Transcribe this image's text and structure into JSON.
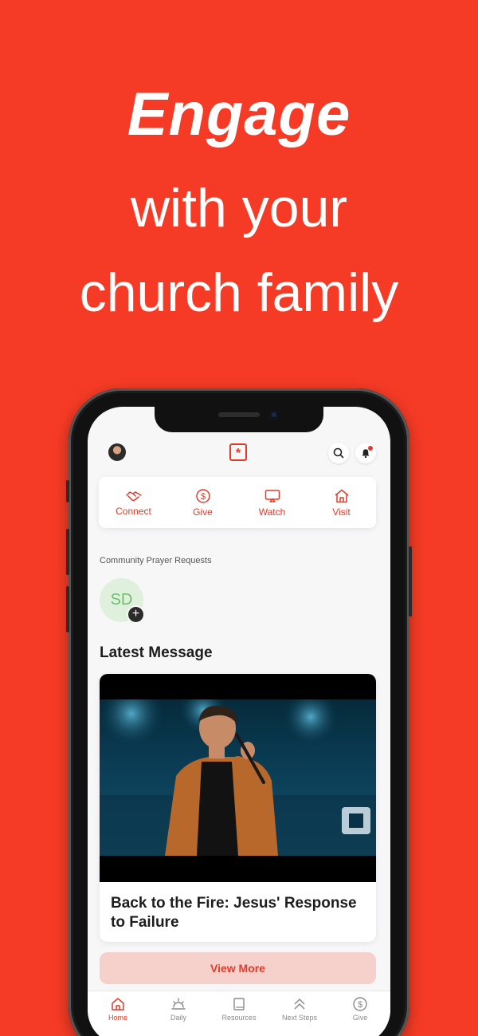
{
  "hero": {
    "line1": "Engage",
    "line2": "with your",
    "line3": "church family"
  },
  "colors": {
    "brand": "#f53b25",
    "accent": "#e23a2a",
    "prayer_bg": "#dff1dc",
    "prayer_text": "#6fbf6a"
  },
  "app": {
    "header": {
      "logo_glyph": "*",
      "icons": [
        "avatar",
        "logo-icon",
        "search-icon",
        "bell-icon"
      ]
    },
    "quick_actions": [
      {
        "label": "Connect",
        "icon": "handshake-icon"
      },
      {
        "label": "Give",
        "icon": "dollar-circle-icon"
      },
      {
        "label": "Watch",
        "icon": "tv-icon"
      },
      {
        "label": "Visit",
        "icon": "house-icon"
      }
    ],
    "prayer": {
      "section_label": "Community Prayer Requests",
      "initials": "SD",
      "add_glyph": "+"
    },
    "latest": {
      "heading": "Latest Message",
      "message_title": "Back to the Fire: Jesus' Response to Failure",
      "view_more": "View More"
    },
    "tabs": [
      {
        "label": "Home",
        "icon": "home-icon",
        "active": true
      },
      {
        "label": "Daily",
        "icon": "sunrise-icon",
        "active": false
      },
      {
        "label": "Resources",
        "icon": "book-icon",
        "active": false
      },
      {
        "label": "Next Steps",
        "icon": "chevrons-up-icon",
        "active": false
      },
      {
        "label": "Give",
        "icon": "dollar-circle-icon",
        "active": false
      }
    ]
  }
}
